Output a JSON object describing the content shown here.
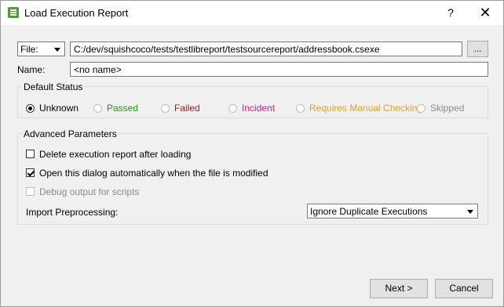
{
  "window": {
    "title": "Load Execution Report",
    "help_label": "?",
    "close_label": "✕"
  },
  "file": {
    "type_label": "File:",
    "path": "C:/dev/squishcoco/tests/testlibreport/testsourcereport/addressbook.csexe",
    "browse_label": "..."
  },
  "name": {
    "label": "Name:",
    "value": "<no name>"
  },
  "default_status": {
    "title": "Default Status",
    "options": [
      {
        "label": "Unknown",
        "color": "#000000",
        "checked": true
      },
      {
        "label": "Passed",
        "color": "#1a9a1a",
        "checked": false
      },
      {
        "label": "Failed",
        "color": "#9a1a1a",
        "checked": false
      },
      {
        "label": "Incident",
        "color": "#d01c8b",
        "checked": false
      },
      {
        "label": "Requires Manual Checking",
        "color": "#e8a020",
        "checked": false
      },
      {
        "label": "Skipped",
        "color": "#8a8a8a",
        "checked": false
      }
    ]
  },
  "advanced": {
    "title": "Advanced Parameters",
    "delete_after_loading": {
      "label": "Delete execution report after loading",
      "checked": false
    },
    "open_auto": {
      "label": "Open this dialog automatically when the file is modified",
      "checked": true
    },
    "debug_output": {
      "label": "Debug output for scripts",
      "checked": false,
      "disabled": true
    },
    "import_label": "Import Preprocessing:",
    "import_value": "Ignore Duplicate Executions"
  },
  "buttons": {
    "next": "Next >",
    "cancel": "Cancel"
  }
}
